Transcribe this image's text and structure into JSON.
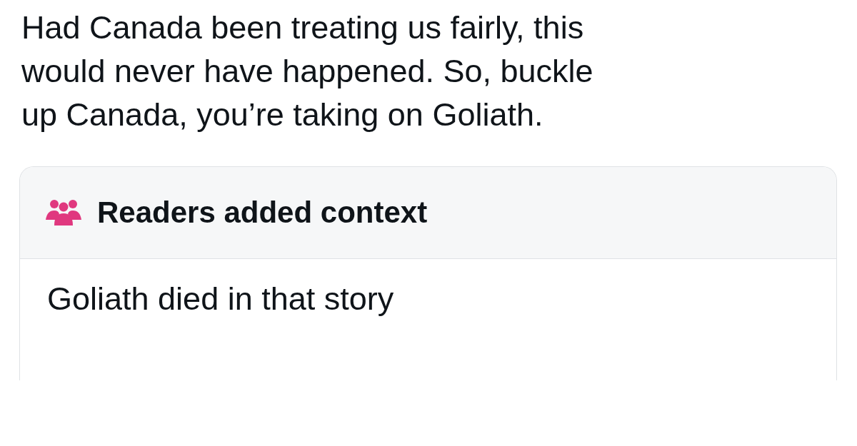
{
  "post": {
    "text_lines": [
      "Had Canada been treating us fairly, this",
      "would never have happened. So, buckle",
      "up Canada, you’re taking on Goliath."
    ]
  },
  "context_note": {
    "heading": "Readers added context",
    "body": "Goliath died in that story"
  }
}
